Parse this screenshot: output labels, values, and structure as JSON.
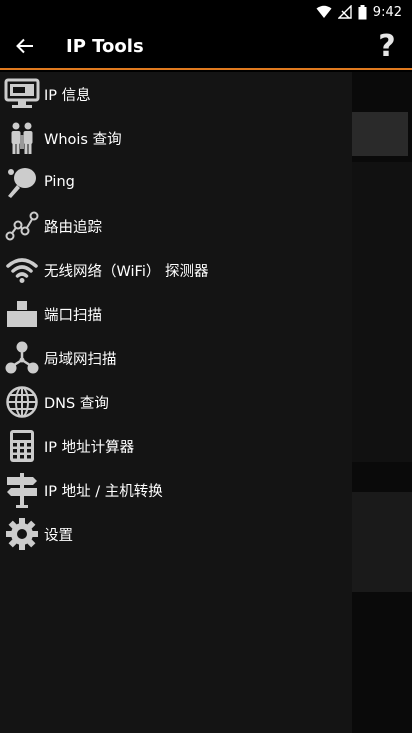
{
  "status_bar": {
    "time": "9:42"
  },
  "app_bar": {
    "title": "IP Tools",
    "help_label": "?"
  },
  "drawer": {
    "items": [
      {
        "label": "IP 信息",
        "icon": "monitor-icon"
      },
      {
        "label": "Whois 查询",
        "icon": "people-icon"
      },
      {
        "label": "Ping",
        "icon": "ping-pong-icon"
      },
      {
        "label": "路由追踪",
        "icon": "route-icon"
      },
      {
        "label": "无线网络（WiFi） 探测器",
        "icon": "wifi-icon"
      },
      {
        "label": "端口扫描",
        "icon": "port-blocks-icon"
      },
      {
        "label": "局域网扫描",
        "icon": "lan-users-icon"
      },
      {
        "label": "DNS 查询",
        "icon": "globe-icon"
      },
      {
        "label": "IP 地址计算器",
        "icon": "calculator-icon"
      },
      {
        "label": "IP 地址 / 主机转换",
        "icon": "signpost-icon"
      },
      {
        "label": "设置",
        "icon": "gear-icon"
      }
    ]
  },
  "colors": {
    "accent": "#e07a1f",
    "drawer_bg": "#141414",
    "background": "#000000"
  }
}
